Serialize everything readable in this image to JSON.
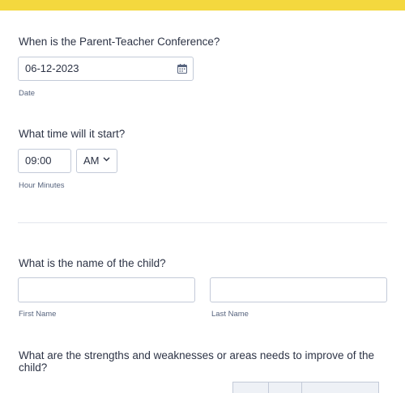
{
  "colors": {
    "accent_bar": "#f4d83e",
    "border": "#c3cad8",
    "text": "#2c3345",
    "subtext": "#57647e"
  },
  "conference": {
    "question": "When is the Parent-Teacher Conference?",
    "date_value": "06-12-2023",
    "date_sublabel": "Date",
    "date_icon": "calendar-icon"
  },
  "time": {
    "question": "What time will it start?",
    "time_value": "09:00",
    "ampm_value": "AM",
    "sublabel": "Hour Minutes"
  },
  "child_name": {
    "question": "What is the name of the child?",
    "first_sublabel": "First Name",
    "last_sublabel": "Last Name"
  },
  "strengths": {
    "question": "What are the strengths and weaknesses or areas needs to improve of the child?"
  }
}
